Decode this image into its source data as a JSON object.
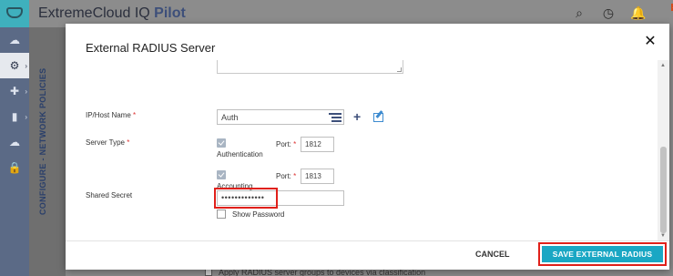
{
  "app": {
    "brand_prefix": "ExtremeCloud IQ",
    "brand_suffix": "Pilot",
    "notification_count": "1"
  },
  "sidepanel": {
    "section_title": "CONFIGURE - NETWORK POLICIES"
  },
  "background": {
    "classification_text": "Apply RADIUS server groups to devices via classification"
  },
  "modal": {
    "title": "External RADIUS Server",
    "close_symbol": "✕",
    "ip_host": {
      "label": "IP/Host Name",
      "required_mark": "*",
      "value": "Auth"
    },
    "server_type": {
      "label": "Server Type",
      "required_mark": "*",
      "authentication": {
        "checked": true,
        "label": "Authentication",
        "port_label": "Port:",
        "port_required": "*",
        "port_value": "1812"
      },
      "accounting": {
        "checked": true,
        "label": "Accounting",
        "port_label": "Port:",
        "port_required": "*",
        "port_value": "1813"
      }
    },
    "shared_secret": {
      "label": "Shared Secret",
      "value": "•••••••••••••",
      "show_password_label": "Show Password",
      "show_password_checked": false
    },
    "buttons": {
      "cancel": "CANCEL",
      "save": "SAVE EXTERNAL RADIUS"
    }
  },
  "colors": {
    "accent": "#1aa7c4",
    "highlight": "#e0201a",
    "brand": "#3d4f7a"
  }
}
